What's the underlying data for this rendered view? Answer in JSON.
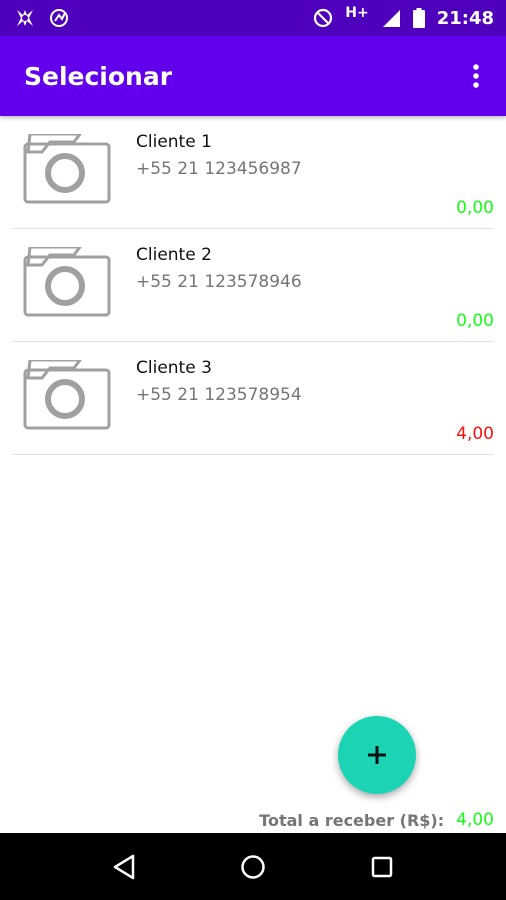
{
  "status_bar": {
    "time": "21:48",
    "network_type": "H+",
    "icons": [
      "app-notification-icon",
      "sync-icon",
      "do-not-disturb-icon",
      "signal-icon",
      "battery-icon"
    ]
  },
  "app_bar": {
    "title": "Selecionar",
    "menu_icon": "overflow-menu-icon"
  },
  "clients": [
    {
      "name": "Cliente 1",
      "phone": "+55 21 123456987",
      "balance": "0,00",
      "balance_status": "zero",
      "photo_icon": "camera-placeholder-icon"
    },
    {
      "name": "Cliente 2",
      "phone": "+55 21 123578946",
      "balance": "0,00",
      "balance_status": "zero",
      "photo_icon": "camera-placeholder-icon"
    },
    {
      "name": "Cliente 3",
      "phone": "+55 21 123578954",
      "balance": "4,00",
      "balance_status": "due",
      "photo_icon": "camera-placeholder-icon"
    }
  ],
  "fab": {
    "icon": "add-icon",
    "label": "+"
  },
  "footer": {
    "total_label": "Total a receber (R$):",
    "total_value": "4,00"
  },
  "colors": {
    "status_bar": "#4e00bd",
    "app_bar": "#6200ee",
    "fab": "#1ad4b4",
    "balance_zero": "#14ff14",
    "balance_due": "#ff1010"
  },
  "nav_bar": {
    "buttons": [
      "back-icon",
      "home-icon",
      "recents-icon"
    ]
  }
}
